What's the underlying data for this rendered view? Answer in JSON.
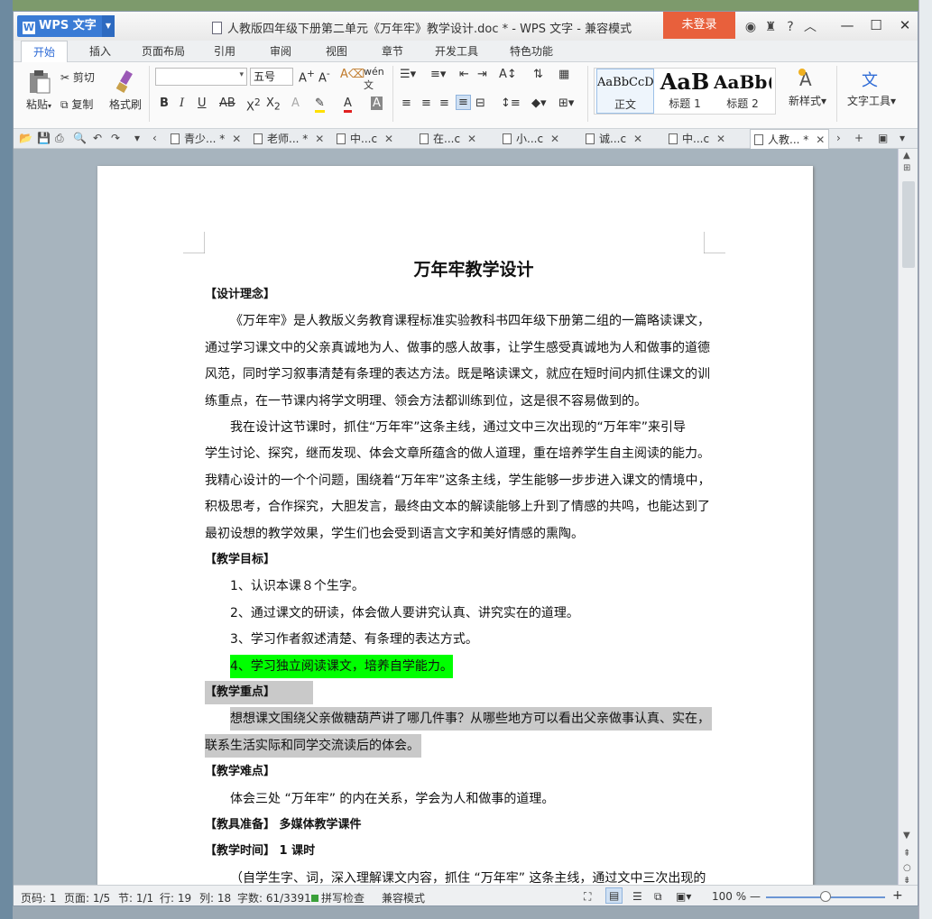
{
  "app": {
    "name": "WPS 文字",
    "title": "人教版四年级下册第二单元《万年牢》教学设计.doc * - WPS 文字 - 兼容模式",
    "login": "未登录"
  },
  "menu": [
    "开始",
    "插入",
    "页面布局",
    "引用",
    "审阅",
    "视图",
    "章节",
    "开发工具",
    "特色功能"
  ],
  "ribbon": {
    "paste": "粘贴",
    "cut": "剪切",
    "copy": "复制",
    "format_painter": "格式刷",
    "font_size": "五号",
    "styles": [
      {
        "preview": "AaBbCcD",
        "name": "正文"
      },
      {
        "preview": "AaB",
        "name": "标题 1"
      },
      {
        "preview": "AaBb(",
        "name": "标题 2"
      }
    ],
    "new_style": "新样式",
    "text_tools": "文字工具"
  },
  "doc_tabs": [
    "青少... *",
    "老师... *",
    "中...c",
    "在...c",
    "小...c",
    "诚...c",
    "中...c",
    "人教... *"
  ],
  "document": {
    "title": "万年牢教学设计",
    "lines": [
      {
        "text": "【设计理念】",
        "kind": "hd"
      },
      {
        "text": "《万年牢》是人教版义务教育课程标准实验教科书四年级下册第二组的一篇略读课文，",
        "kind": "ind"
      },
      {
        "text": "通过学习课文中的父亲真诚地为人、做事的感人故事，让学生感受真诚地为人和做事的道德",
        "kind": "p"
      },
      {
        "text": "风范，同时学习叙事清楚有条理的表达方法。既是略读课文，就应在短时间内抓住课文的训",
        "kind": "p"
      },
      {
        "text": "练重点，在一节课内将学文明理、领会方法都训练到位，这是很不容易做到的。",
        "kind": "p"
      },
      {
        "text": "我在设计这节课时，抓住“万年牢”这条主线，通过文中三次出现的“万年牢”来引导",
        "kind": "ind"
      },
      {
        "text": "学生讨论、探究，继而发现、体会文章所蕴含的做人道理，重在培养学生自主阅读的能力。",
        "kind": "p"
      },
      {
        "text": "我精心设计的一个个问题，围绕着“万年牢”这条主线，学生能够一步步进入课文的情境中，",
        "kind": "p"
      },
      {
        "text": "积极思考，合作探究，大胆发言，最终由文本的解读能够上升到了情感的共鸣，也能达到了",
        "kind": "p"
      },
      {
        "text": "最初设想的教学效果，学生们也会受到语言文字和美好情感的熏陶。",
        "kind": "p"
      },
      {
        "text": "【教学目标】",
        "kind": "hd"
      },
      {
        "text": "1、认识本课８个生字。",
        "kind": "ind"
      },
      {
        "text": "2、通过课文的研读，体会做人要讲究认真、讲究实在的道理。",
        "kind": "ind"
      },
      {
        "text": "3、学习作者叙述清楚、有条理的表达方式。",
        "kind": "ind"
      },
      {
        "text": "4、学习独立阅读课文，培养自学能力。",
        "kind": "ind hl"
      },
      {
        "text": "【教学重点】",
        "kind": "hd gray"
      },
      {
        "text": "想想课文围绕父亲做糖葫芦讲了哪几件事？从哪些地方可以看出父亲做事认真、实在，",
        "kind": "ind gray"
      },
      {
        "text": "联系生活实际和同学交流读后的体会。",
        "kind": "p gray"
      },
      {
        "text": "【教学难点】",
        "kind": "hd"
      },
      {
        "text": "体会三处 “万年牢” 的内在关系，学会为人和做事的道理。",
        "kind": "ind"
      },
      {
        "text": "【教具准备】    多媒体教学课件",
        "kind": "hd"
      },
      {
        "text": "【教学时间】     1 课时",
        "kind": "hd"
      },
      {
        "text": "（自学生字、词，深入理解课文内容，抓住 “万年牢” 这条主线，通过文中三次出现的",
        "kind": "ind"
      }
    ]
  },
  "status": {
    "page_num": "页码: 1",
    "pages": "页面: 1/5",
    "section": "节: 1/1",
    "row": "行: 19",
    "col": "列: 18",
    "words": "字数: 61/3391",
    "spell": "拼写检查",
    "mode": "兼容模式",
    "zoom": "100 %"
  },
  "colors": {
    "accent": "#2e6bd6",
    "login": "#e8603c",
    "highlight": "#00ff00",
    "selection": "#c9c9c9"
  }
}
